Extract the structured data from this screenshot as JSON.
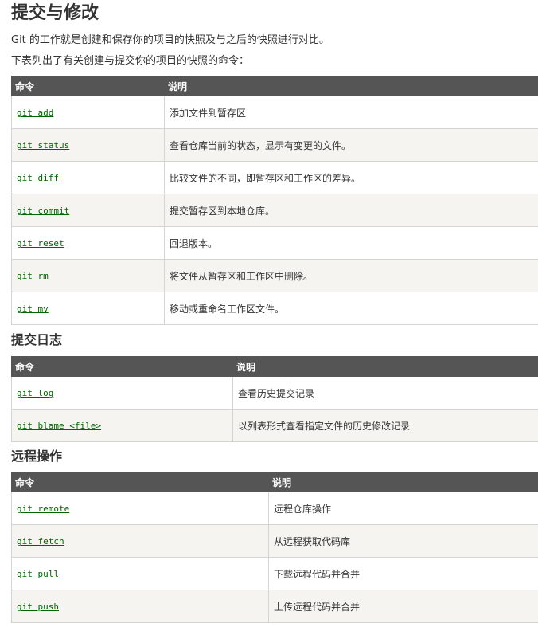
{
  "title": "提交与修改",
  "intro": "Git 的工作就是创建和保存你的项目的快照及与之后的快照进行对比。",
  "table_intro": "下表列出了有关创建与提交你的项目的快照的命令：",
  "colors": {
    "header_bg": "#555555",
    "link": "#006600",
    "alt_row": "#f6f4f0"
  },
  "table1": {
    "headers": [
      "命令",
      "说明"
    ],
    "rows": [
      {
        "cmd": "git add",
        "desc": "添加文件到暂存区"
      },
      {
        "cmd": "git status",
        "desc": "查看仓库当前的状态，显示有变更的文件。"
      },
      {
        "cmd": "git diff",
        "desc": "比较文件的不同，即暂存区和工作区的差异。"
      },
      {
        "cmd": "git commit",
        "desc": "提交暂存区到本地仓库。"
      },
      {
        "cmd": "git reset",
        "desc": "回退版本。"
      },
      {
        "cmd": "git rm",
        "desc": "将文件从暂存区和工作区中删除。"
      },
      {
        "cmd": "git mv",
        "desc": "移动或重命名工作区文件。"
      }
    ]
  },
  "section2": {
    "title": "提交日志",
    "headers": [
      "命令",
      "说明"
    ],
    "rows": [
      {
        "cmd": "git log",
        "desc": "查看历史提交记录"
      },
      {
        "cmd": "git blame <file>",
        "desc": "以列表形式查看指定文件的历史修改记录"
      }
    ]
  },
  "section3": {
    "title": "远程操作",
    "headers": [
      "命令",
      "说明"
    ],
    "rows": [
      {
        "cmd": "git remote",
        "desc": "远程仓库操作"
      },
      {
        "cmd": "git fetch",
        "desc": "从远程获取代码库"
      },
      {
        "cmd": "git pull",
        "desc": "下载远程代码并合并"
      },
      {
        "cmd": "git push",
        "desc": "上传远程代码并合并"
      }
    ]
  }
}
